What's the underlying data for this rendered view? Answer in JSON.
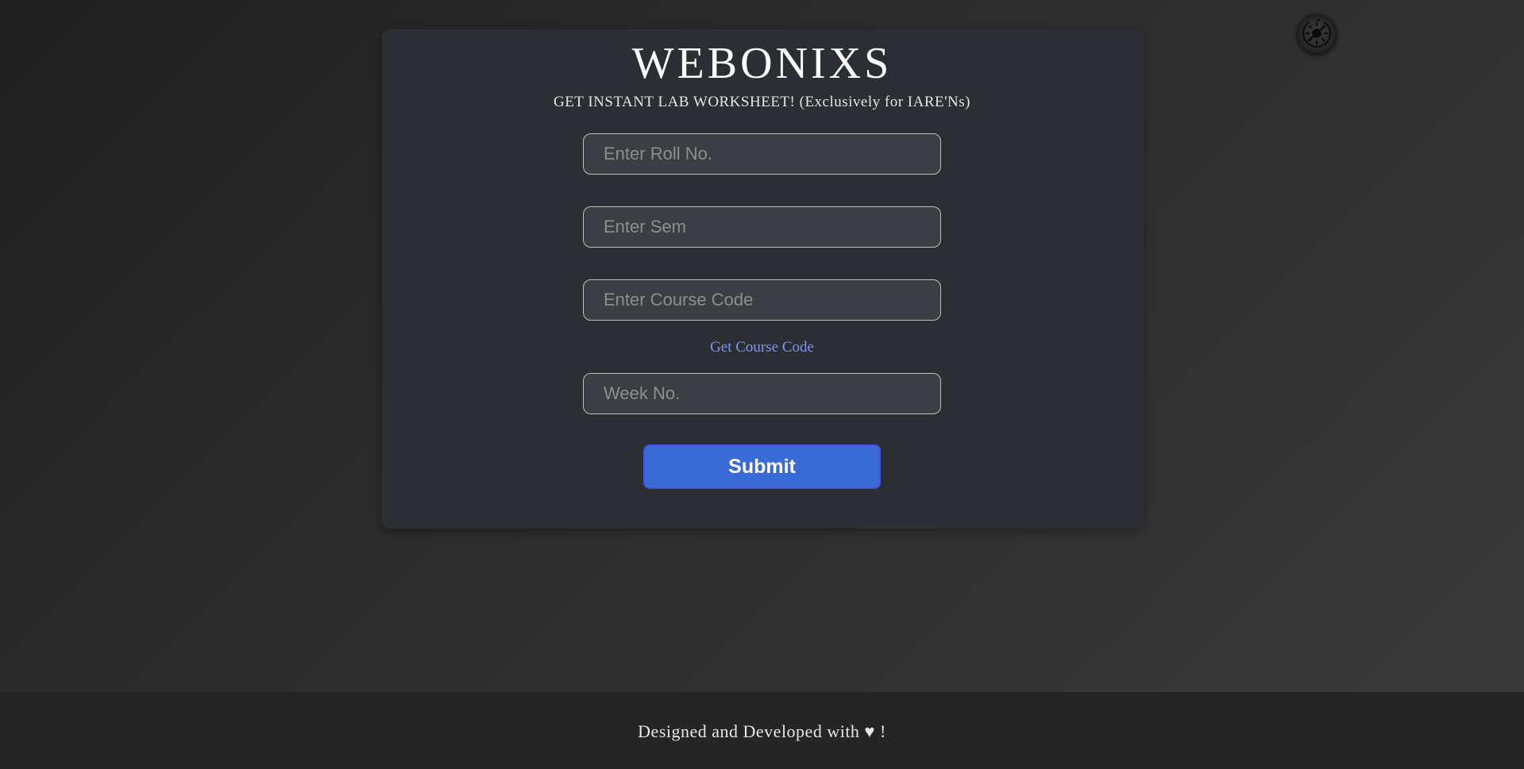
{
  "theme_toggle": {
    "icon": "brightness-off-icon"
  },
  "header": {
    "brand": "WEBONIXS",
    "subtitle": "GET INSTANT LAB WORKSHEET! (Exclusively for IARE'Ns)"
  },
  "form": {
    "roll_placeholder": "Enter Roll No.",
    "sem_placeholder": "Enter Sem",
    "course_code_placeholder": "Enter Course Code",
    "course_code_link": "Get Course Code",
    "week_placeholder": "Week No.",
    "submit_label": "Submit"
  },
  "footer": {
    "text": "Designed and Developed with ♥ !"
  },
  "colors": {
    "accent": "#3a6ad6",
    "link": "#7f95f2",
    "card": "#2b2e32"
  }
}
